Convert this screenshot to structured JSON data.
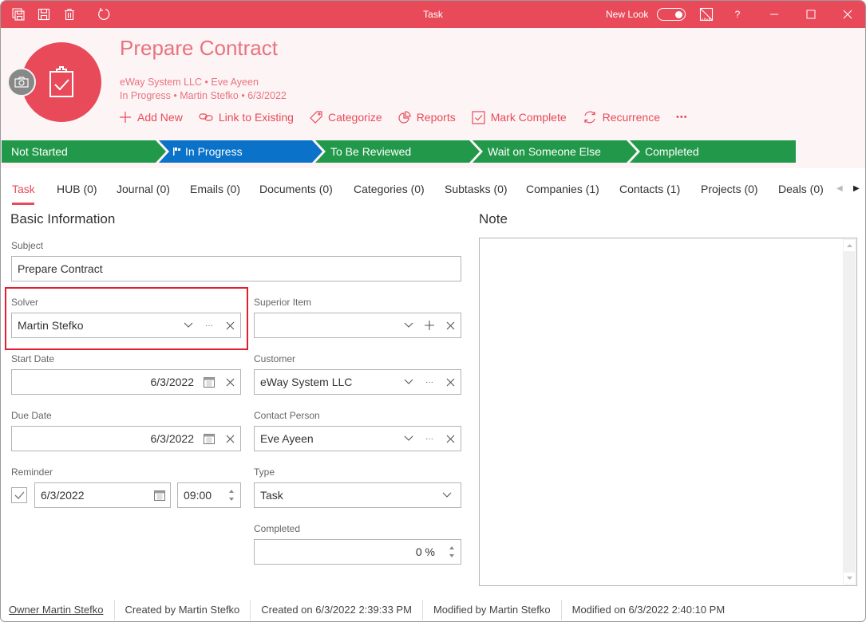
{
  "window": {
    "title": "Task",
    "new_look_label": "New Look",
    "new_look_enabled": true,
    "help_label": "?"
  },
  "colors": {
    "accent": "#e84a5a",
    "accent_text": "#e8737f",
    "stage_done": "#22994a",
    "stage_current": "#0a72c8",
    "highlight_border": "#e02030"
  },
  "header": {
    "title": "Prepare Contract",
    "meta_line1": "eWay System LLC • Eve Ayeen",
    "meta_line2": "In Progress • Martin Stefko • 6/3/2022",
    "actions": [
      {
        "label": "Add New",
        "icon": "plus-icon"
      },
      {
        "label": "Link to Existing",
        "icon": "link-icon"
      },
      {
        "label": "Categorize",
        "icon": "tag-icon"
      },
      {
        "label": "Reports",
        "icon": "pie-chart-icon"
      },
      {
        "label": "Mark Complete",
        "icon": "checkbox-icon"
      },
      {
        "label": "Recurrence",
        "icon": "refresh-icon"
      }
    ],
    "more_label": "•••"
  },
  "stages": [
    {
      "label": "Not Started",
      "state": "done"
    },
    {
      "label": "In Progress",
      "state": "current"
    },
    {
      "label": "To Be Reviewed",
      "state": "pending"
    },
    {
      "label": "Wait on Someone Else",
      "state": "pending"
    },
    {
      "label": "Completed",
      "state": "pending"
    }
  ],
  "tabs": [
    {
      "label": "Task",
      "active": true
    },
    {
      "label": "HUB (0)"
    },
    {
      "label": "Journal (0)"
    },
    {
      "label": "Emails (0)"
    },
    {
      "label": "Documents (0)"
    },
    {
      "label": "Categories (0)"
    },
    {
      "label": "Subtasks (0)"
    },
    {
      "label": "Companies (1)"
    },
    {
      "label": "Contacts (1)"
    },
    {
      "label": "Projects (0)"
    },
    {
      "label": "Deals (0)"
    }
  ],
  "form": {
    "section_title": "Basic Information",
    "subject": {
      "label": "Subject",
      "value": "Prepare Contract"
    },
    "solver": {
      "label": "Solver",
      "value": "Martin Stefko"
    },
    "superior_item": {
      "label": "Superior Item",
      "value": ""
    },
    "start_date": {
      "label": "Start Date",
      "value": "6/3/2022"
    },
    "customer": {
      "label": "Customer",
      "value": "eWay System LLC"
    },
    "due_date": {
      "label": "Due Date",
      "value": "6/3/2022"
    },
    "contact_person": {
      "label": "Contact Person",
      "value": "Eve Ayeen"
    },
    "reminder": {
      "label": "Reminder",
      "checked": true,
      "date": "6/3/2022",
      "time": "09:00"
    },
    "type": {
      "label": "Type",
      "value": "Task"
    },
    "completed": {
      "label": "Completed",
      "value": "0 %"
    }
  },
  "note": {
    "title": "Note",
    "value": ""
  },
  "footer": {
    "owner": "Owner Martin Stefko",
    "created_by": "Created by Martin Stefko",
    "created_on": "Created on 6/3/2022 2:39:33 PM",
    "modified_by": "Modified by Martin Stefko",
    "modified_on": "Modified on 6/3/2022 2:40:10 PM"
  }
}
